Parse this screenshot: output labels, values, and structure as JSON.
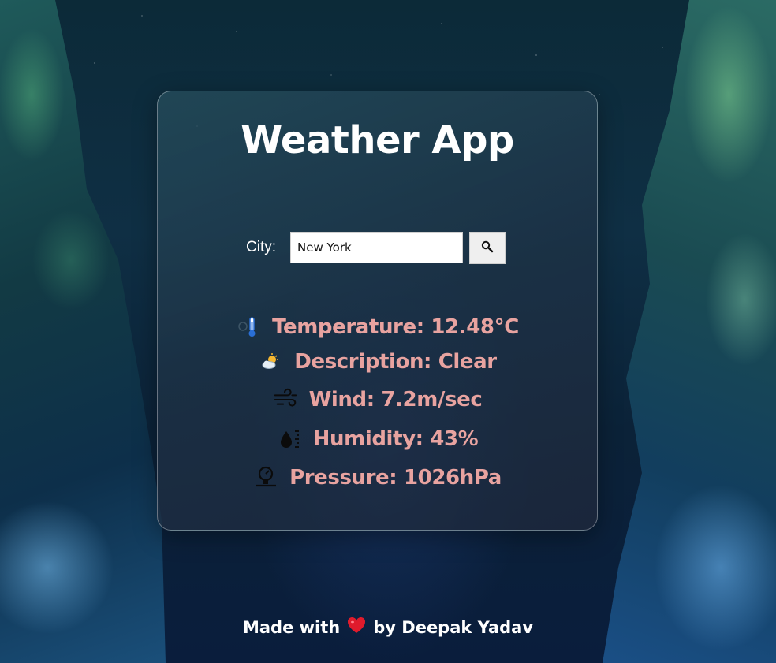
{
  "app": {
    "title": "Weather App"
  },
  "search": {
    "label": "City:",
    "value": "New York",
    "button_icon": "search-icon"
  },
  "weather": {
    "temperature": {
      "icon": "thermometer-icon",
      "text": "Temperature: 12.48°C"
    },
    "description": {
      "icon": "sun-cloud-icon",
      "text": "Description: Clear"
    },
    "wind": {
      "icon": "wind-icon",
      "text": "Wind: 7.2m/sec"
    },
    "humidity": {
      "icon": "humidity-icon",
      "text": "Humidity: 43%"
    },
    "pressure": {
      "icon": "pressure-gauge-icon",
      "text": "Pressure: 1026hPa"
    }
  },
  "footer": {
    "prefix": "Made with",
    "heart_icon": "heart-icon",
    "suffix": "by Deepak Yadav"
  },
  "colors": {
    "info_text": "#e8a3a0",
    "title": "#ffffff"
  }
}
